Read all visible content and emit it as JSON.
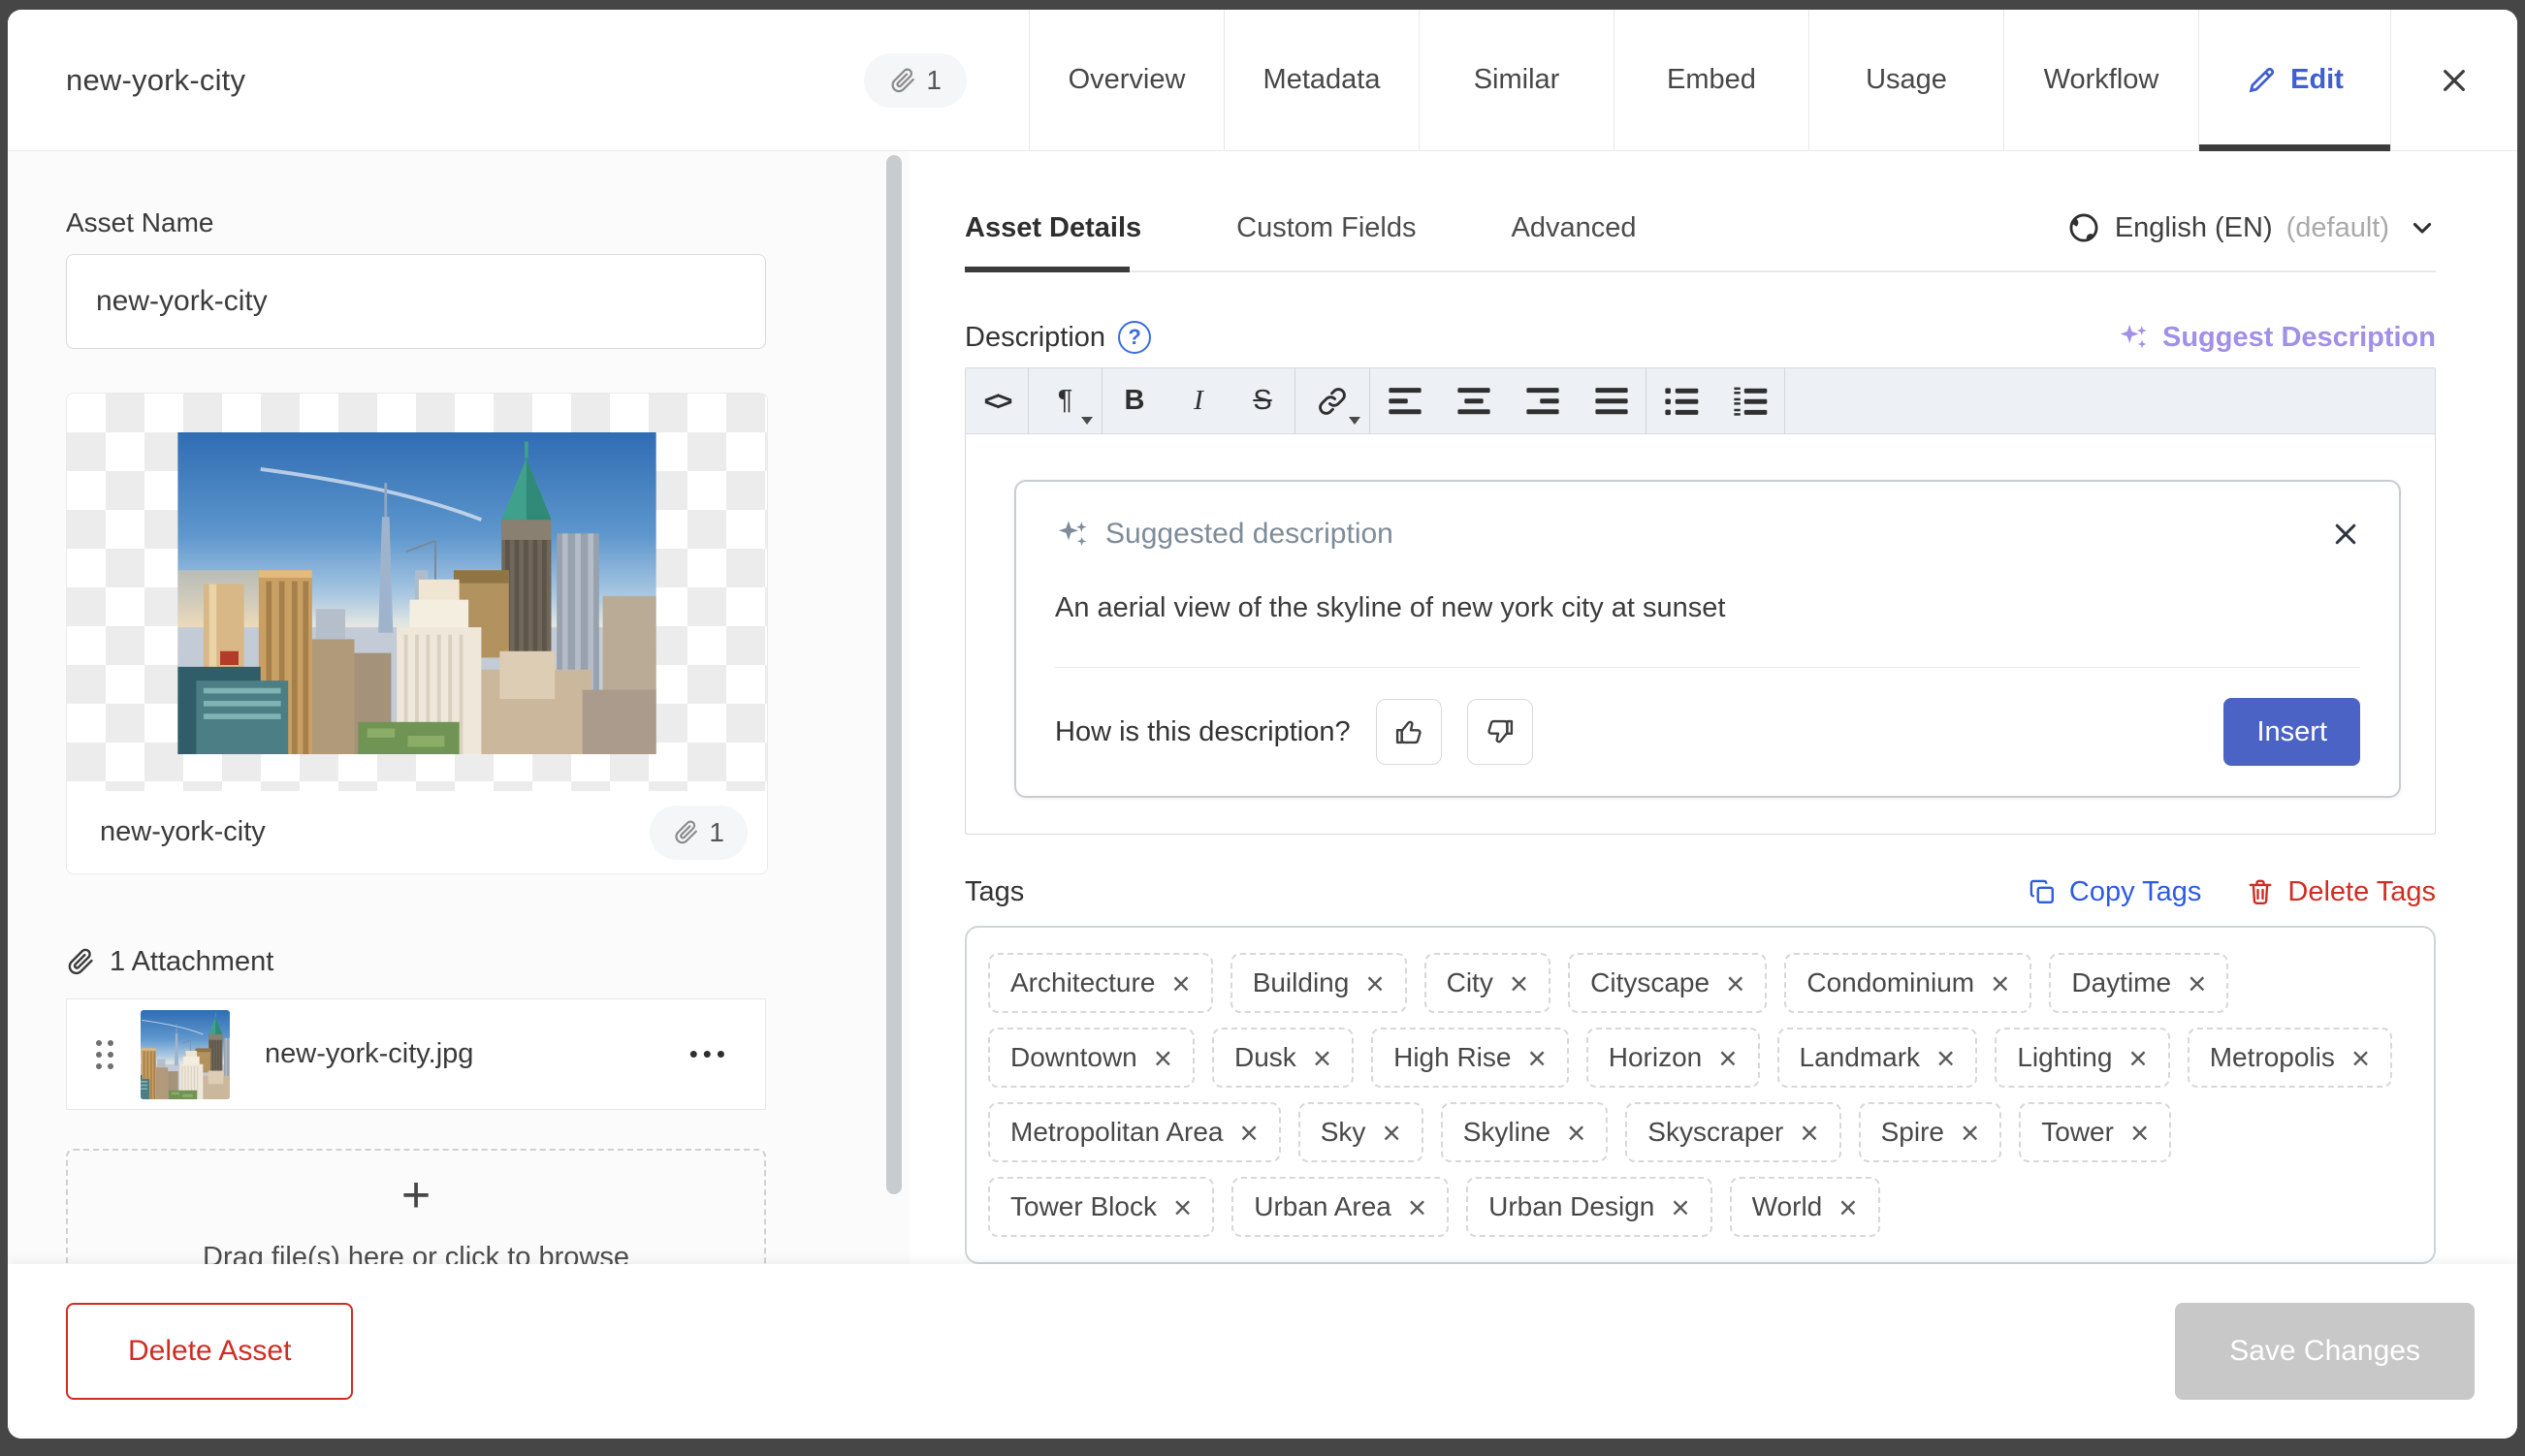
{
  "header": {
    "title": "new-york-city",
    "attachment_count": "1",
    "tabs": [
      {
        "label": "Overview"
      },
      {
        "label": "Metadata"
      },
      {
        "label": "Similar"
      },
      {
        "label": "Embed"
      },
      {
        "label": "Usage"
      },
      {
        "label": "Workflow"
      }
    ],
    "edit_tab_label": "Edit"
  },
  "left": {
    "asset_name_label": "Asset Name",
    "asset_name_value": "new-york-city",
    "preview_caption": "new-york-city",
    "preview_attachment_count": "1",
    "attachments_header": "1 Attachment",
    "attachment_filename": "new-york-city.jpg",
    "attachment_menu": "•••",
    "dropzone_plus": "+",
    "dropzone_text": "Drag file(s) here or click to browse",
    "delete_button": "Delete Asset"
  },
  "right": {
    "subtabs": [
      {
        "label": "Asset Details",
        "active": true
      },
      {
        "label": "Custom Fields",
        "active": false
      },
      {
        "label": "Advanced",
        "active": false
      }
    ],
    "language": {
      "name": "English (EN)",
      "default_label": "(default)"
    },
    "description": {
      "label": "Description",
      "help_glyph": "?",
      "suggest_button": "Suggest Description"
    },
    "toolbar": {
      "code": "<>",
      "paragraph": "¶",
      "bold": "B",
      "italic": "I",
      "strike": "S"
    },
    "suggestion": {
      "title": "Suggested description",
      "body": "An aerial view of the skyline of new york city at sunset",
      "question": "How is this description?",
      "insert_button": "Insert"
    },
    "tags": {
      "label": "Tags",
      "copy_button": "Copy Tags",
      "delete_button": "Delete Tags",
      "remove_icon": "×",
      "items": [
        {
          "label": "Architecture"
        },
        {
          "label": "Building"
        },
        {
          "label": "City"
        },
        {
          "label": "Cityscape"
        },
        {
          "label": "Condominium"
        },
        {
          "label": "Daytime"
        },
        {
          "label": "Downtown"
        },
        {
          "label": "Dusk"
        },
        {
          "label": "High Rise"
        },
        {
          "label": "Horizon"
        },
        {
          "label": "Landmark"
        },
        {
          "label": "Lighting"
        },
        {
          "label": "Metropolis"
        },
        {
          "label": "Metropolitan Area"
        },
        {
          "label": "Sky"
        },
        {
          "label": "Skyline"
        },
        {
          "label": "Skyscraper"
        },
        {
          "label": "Spire"
        },
        {
          "label": "Tower"
        },
        {
          "label": "Tower Block"
        },
        {
          "label": "Urban Area"
        },
        {
          "label": "Urban Design"
        },
        {
          "label": "World"
        }
      ]
    }
  },
  "footer": {
    "save_button": "Save Changes"
  },
  "colors": {
    "edit_tab_blue": "#3f5ed0",
    "insert_blue": "#4a63c4",
    "suggest_purple": "#a090e8",
    "copy_tags_blue": "#2c5ce0",
    "danger_red": "#cf2d23",
    "suggestion_slate": "#7e8b99",
    "disabled_save_gray": "#c8c8c8",
    "frame_gray": "#464646"
  }
}
